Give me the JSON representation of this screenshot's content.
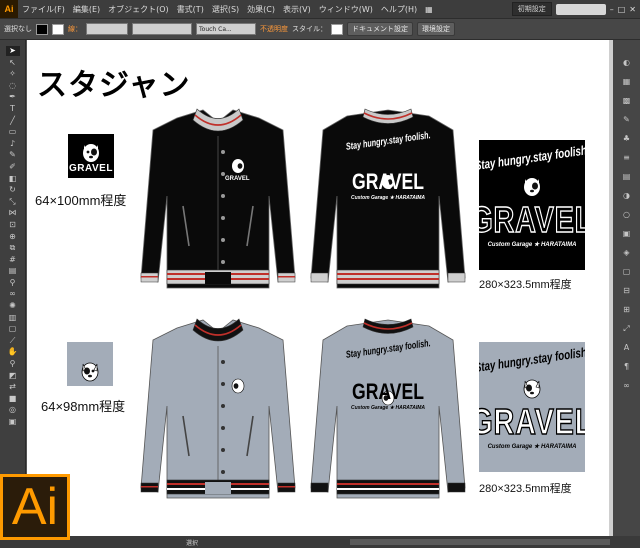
{
  "app": {
    "logo": "Ai",
    "menus": [
      "ファイル(F)",
      "編集(E)",
      "オブジェクト(O)",
      "書式(T)",
      "選択(S)",
      "効果(C)",
      "表示(V)",
      "ウィンドウ(W)",
      "ヘルプ(H)"
    ],
    "workspace": "初期設定"
  },
  "controlbar": {
    "selection": "選択なし",
    "stroke_label": "線：",
    "brush": "Touch Ca...",
    "opacity_label": "不透明度",
    "style_label": "スタイル：",
    "doc_settings": "ドキュメント設定",
    "preferences": "環境設定"
  },
  "status": {
    "zoom": "",
    "tool": "選択"
  },
  "artboard": {
    "title": "スタジャン",
    "black_set": {
      "front_logo_size": "64×100mm程度",
      "back_size": "280×323.5mm程度"
    },
    "gray_set": {
      "front_logo_size": "64×98mm程度",
      "back_size": "280×323.5mm程度"
    }
  },
  "print": {
    "brand": "GRAVEL",
    "slogan": "Stay hungry.stay foolish.",
    "sub": "Custom Garage ★ HARATAIMA"
  },
  "colors": {
    "accent_orange": "#ff9a00",
    "jacket_black": "#0a0a0a",
    "jacket_gray": "#a3acb8",
    "rib_red": "#c0302a"
  }
}
